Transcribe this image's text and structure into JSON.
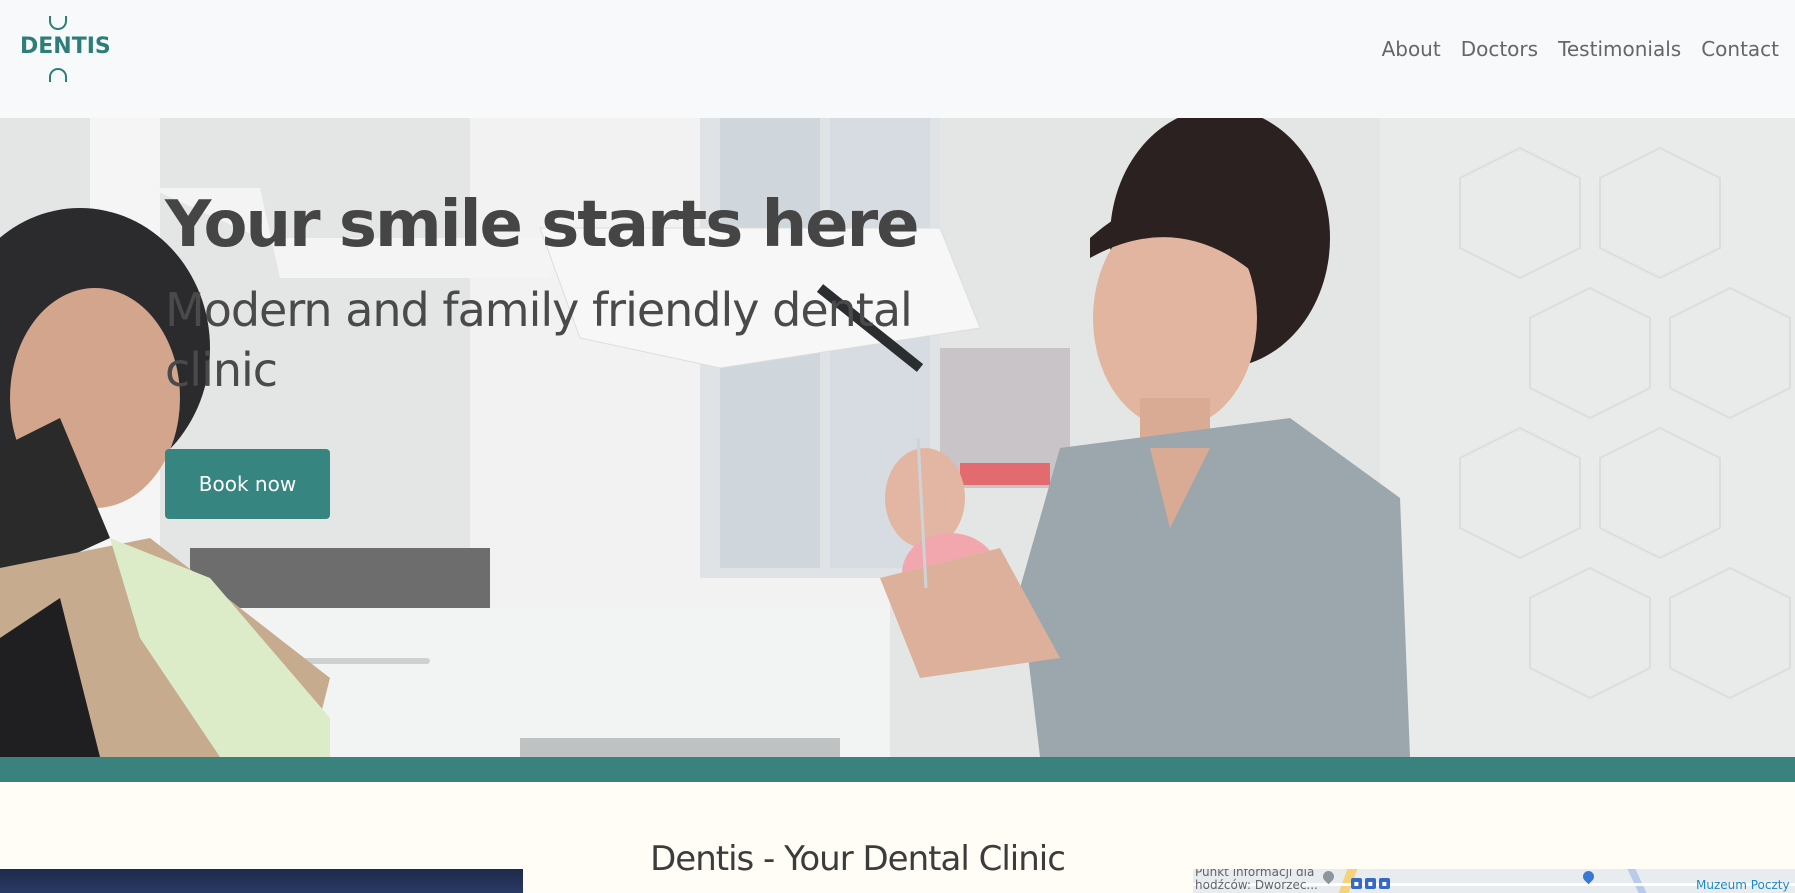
{
  "header": {
    "logo_text": "DENTIS",
    "nav": [
      {
        "label": "About"
      },
      {
        "label": "Doctors"
      },
      {
        "label": "Testimonials"
      },
      {
        "label": "Contact"
      }
    ]
  },
  "hero": {
    "title": "Your smile starts here",
    "subtitle": "Modern and family friendly dental clinic",
    "cta_label": "Book now"
  },
  "section": {
    "title": "Dentis - Your Dental Clinic"
  },
  "map": {
    "label_left_line1": "Punkt informacji dla",
    "label_left_line2": "hodźców: Dworzec...",
    "label_right": "Muzeum Poczty"
  },
  "colors": {
    "brand": "#368581",
    "band": "#3a827d",
    "header_bg": "#f7f9fb",
    "page_bg": "#fffdf6",
    "text_dark": "#454545"
  }
}
